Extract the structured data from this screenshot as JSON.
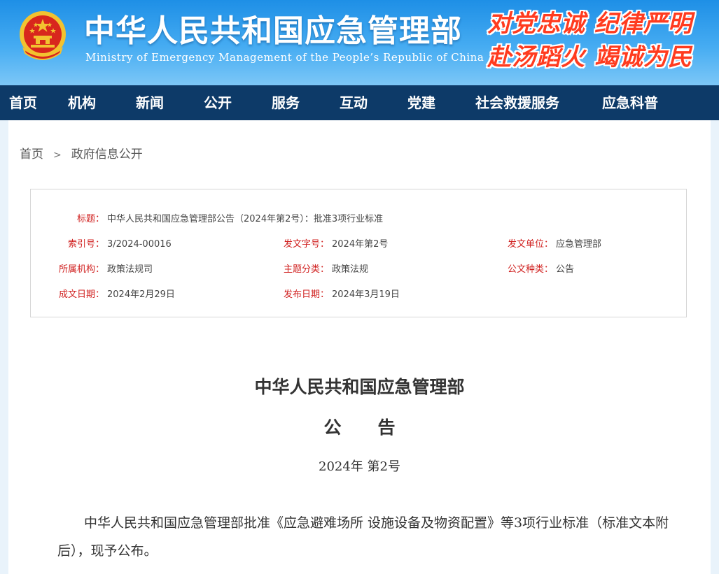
{
  "header": {
    "title": "中华人民共和国应急管理部",
    "subtitle": "Ministry of Emergency Management of the People’s Republic of China",
    "slogan_line1": "对党忠诚 纪律严明",
    "slogan_line2": "赴汤蹈火 竭诚为民",
    "emblem_icon": "national-emblem-icon"
  },
  "nav": {
    "items": [
      "首页",
      "机构",
      "新闻",
      "公开",
      "服务",
      "互动",
      "党建",
      "社会救援服务",
      "应急科普"
    ]
  },
  "breadcrumb": {
    "home": "首页",
    "separator": ">",
    "current": "政府信息公开"
  },
  "info": {
    "title_label": "标题：",
    "title_value": "中华人民共和国应急管理部公告（2024年第2号）：批准3项行业标准",
    "index_label": "索引号：",
    "index_value": "3/2024-00016",
    "doc_no_label": "发文字号：",
    "doc_no_value": "2024年第2号",
    "issuer_label": "发文单位：",
    "issuer_value": "应急管理部",
    "org_label": "所属机构：",
    "org_value": "政策法规司",
    "topic_label": "主题分类：",
    "topic_value": "政策法规",
    "type_label": "公文种类：",
    "type_value": "公告",
    "created_label": "成文日期：",
    "created_value": "2024年2月29日",
    "published_label": "发布日期：",
    "published_value": "2024年3月19日"
  },
  "document": {
    "title_line1": "中华人民共和国应急管理部",
    "title_line2": "公告",
    "number": "2024年  第2号",
    "body": "中华人民共和国应急管理部批准《应急避难场所 设施设备及物资配置》等3项行业标准（标准文本附后），现予公布。"
  },
  "colors": {
    "header_blue": "#1e8fe6",
    "nav_bg": "#0d3a68",
    "label_red": "#d0201f",
    "slogan_red": "#ff3b1f"
  }
}
